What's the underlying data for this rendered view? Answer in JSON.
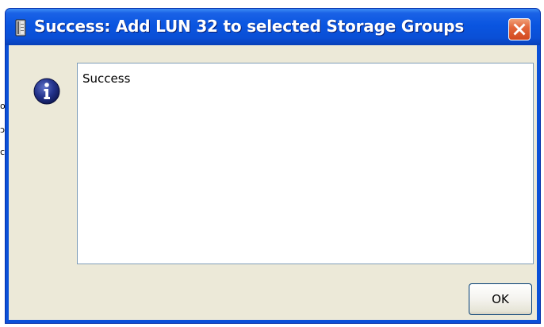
{
  "dialog": {
    "title": "Success: Add LUN 32 to selected Storage Groups",
    "message": "Success",
    "ok_label": "OK",
    "app_icon": "storage-server-icon",
    "message_icon": "information-icon",
    "close_icon": "close-icon"
  },
  "background": {
    "edge_glyphs": [
      "o",
      "ɔ",
      "c"
    ]
  },
  "colors": {
    "titlebar": "#0a55e0",
    "dialog_face": "#ece9d8",
    "close_button": "#e3673c",
    "info_icon": "#1f2f80",
    "border_accent": "#003c74"
  }
}
